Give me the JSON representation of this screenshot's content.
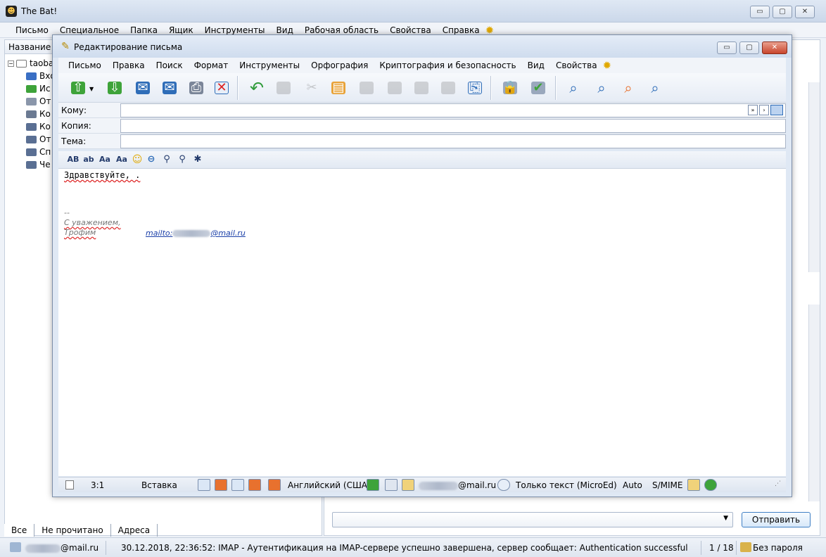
{
  "main_window": {
    "title": "The Bat!",
    "controls": {
      "minimize": "▭",
      "maximize": "▢",
      "close": "✕"
    }
  },
  "main_menu": [
    "Письмо",
    "Специальное",
    "Папка",
    "Ящик",
    "Инструменты",
    "Вид",
    "Рабочая область",
    "Свойства",
    "Справка"
  ],
  "left_panel": {
    "header": "Название",
    "account": "taoba",
    "folders": [
      "Вхо",
      "Ис",
      "От",
      "Ко",
      "Ко",
      "От",
      "Сп",
      "Че"
    ]
  },
  "left_tabs": [
    "Все",
    "Не прочитано",
    "Адреса"
  ],
  "send_button": "Отправить",
  "main_status": {
    "account_suffix": "@mail.ru",
    "log": "30.12.2018, 22:36:52: IMAP  - Аутентификация на IMAP-сервере успешно завершена, сервер сообщает: Authentication successful",
    "counter": "1 / 18",
    "password": "Без пароля"
  },
  "editor": {
    "title": "Редактирование письма",
    "menu": [
      "Письмо",
      "Правка",
      "Поиск",
      "Формат",
      "Инструменты",
      "Орфография",
      "Криптография и безопасность",
      "Вид",
      "Свойства"
    ],
    "fields": {
      "to_label": "Кому:",
      "cc_label": "Копия:",
      "subject_label": "Тема:"
    },
    "format_buttons": [
      "AB",
      "ab",
      "Aa",
      "Aa"
    ],
    "body": {
      "greeting": "Здравствуйте, .",
      "sig_sep": "--",
      "sig_line1": "С уважением,",
      "sig_line2": "Трофим",
      "mailto_prefix": "mailto:",
      "mailto_suffix": "@mail.ru"
    },
    "status": {
      "position": "3:1",
      "mode": "Вставка",
      "language": "Английский (США)",
      "email_suffix": "@mail.ru",
      "editor_mode": "Только текст (MicroEd)",
      "encoding": "Auto",
      "security": "S/MIME"
    }
  },
  "colors": {
    "accent_blue": "#2f6db8",
    "green": "#3ea33a",
    "orange": "#e8712e",
    "send_border": "#3f7fc4"
  }
}
